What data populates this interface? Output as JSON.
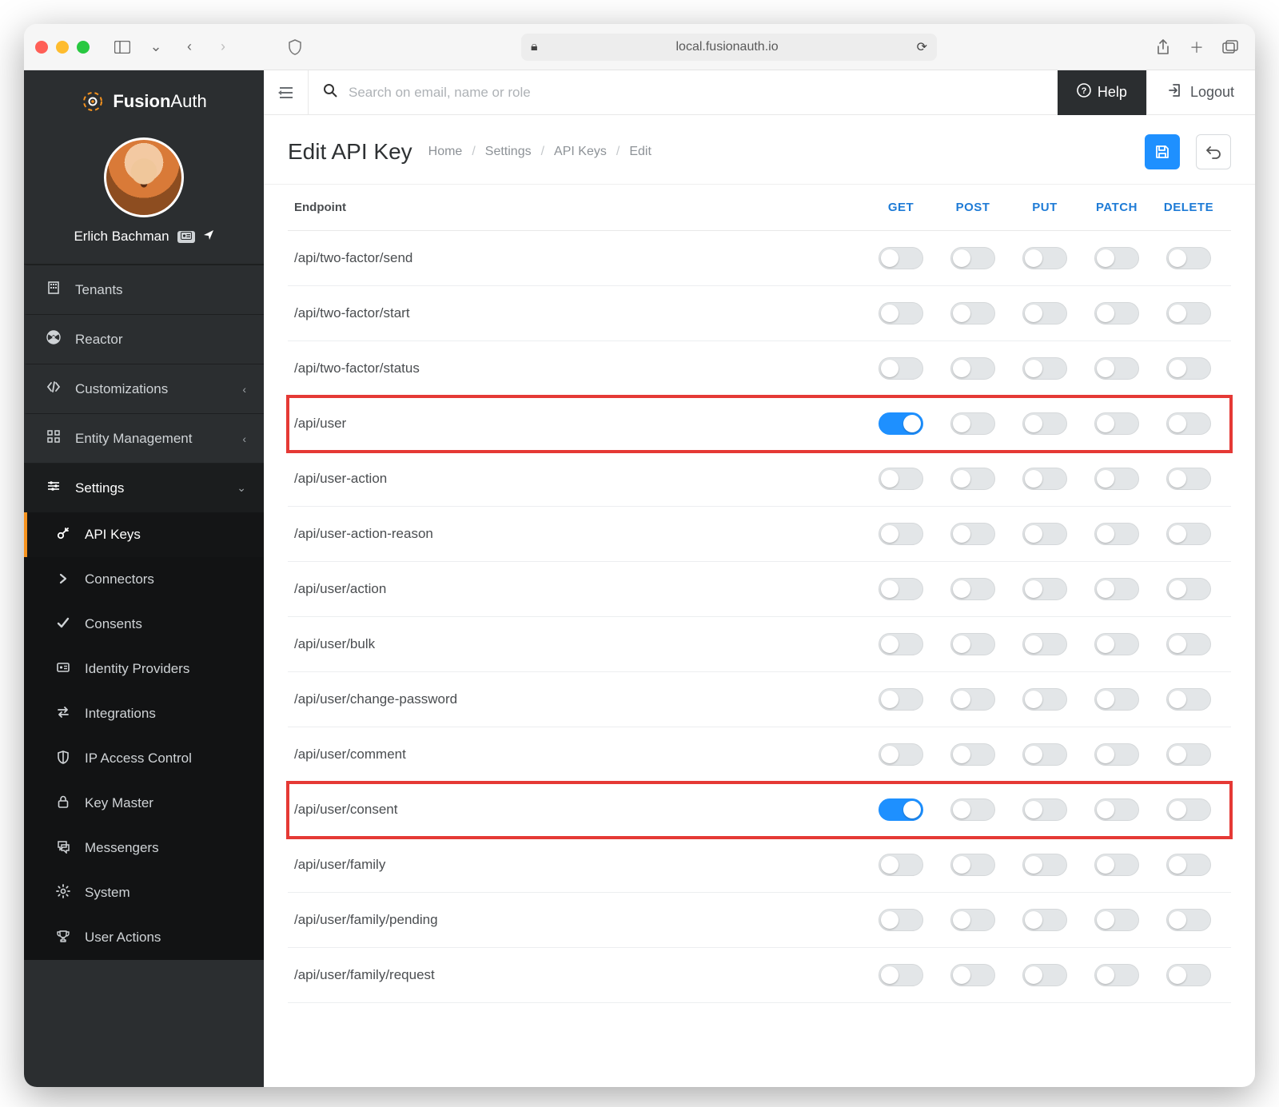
{
  "browser": {
    "url": "local.fusionauth.io"
  },
  "brand": {
    "name_a": "Fusion",
    "name_b": "Auth"
  },
  "profile": {
    "name": "Erlich Bachman"
  },
  "sidebar": {
    "primary": [
      {
        "icon": "building",
        "label": "Tenants"
      },
      {
        "icon": "nuclear",
        "label": "Reactor"
      }
    ],
    "groups": [
      {
        "icon": "code",
        "label": "Customizations",
        "expandable": true
      },
      {
        "icon": "grid",
        "label": "Entity Management",
        "expandable": true
      },
      {
        "icon": "sliders",
        "label": "Settings",
        "expandable": true,
        "open": true
      }
    ],
    "settings_children": [
      {
        "icon": "key",
        "label": "API Keys",
        "active": true
      },
      {
        "icon": "chevron",
        "label": "Connectors"
      },
      {
        "icon": "check",
        "label": "Consents"
      },
      {
        "icon": "idcard",
        "label": "Identity Providers"
      },
      {
        "icon": "swap",
        "label": "Integrations"
      },
      {
        "icon": "shield",
        "label": "IP Access Control"
      },
      {
        "icon": "lock",
        "label": "Key Master"
      },
      {
        "icon": "chat",
        "label": "Messengers"
      },
      {
        "icon": "gear",
        "label": "System"
      },
      {
        "icon": "trophy",
        "label": "User Actions"
      }
    ]
  },
  "topbar": {
    "search_placeholder": "Search on email, name or role",
    "help": "Help",
    "logout": "Logout"
  },
  "page": {
    "title": "Edit API Key",
    "crumbs": [
      "Home",
      "Settings",
      "API Keys",
      "Edit"
    ]
  },
  "table": {
    "headers": {
      "endpoint": "Endpoint",
      "methods": [
        "GET",
        "POST",
        "PUT",
        "PATCH",
        "DELETE"
      ]
    },
    "rows": [
      {
        "endpoint": "/api/two-factor/send",
        "get": false,
        "post": false,
        "put": false,
        "patch": false,
        "delete": false,
        "highlight": false
      },
      {
        "endpoint": "/api/two-factor/start",
        "get": false,
        "post": false,
        "put": false,
        "patch": false,
        "delete": false,
        "highlight": false
      },
      {
        "endpoint": "/api/two-factor/status",
        "get": false,
        "post": false,
        "put": false,
        "patch": false,
        "delete": false,
        "highlight": false
      },
      {
        "endpoint": "/api/user",
        "get": true,
        "post": false,
        "put": false,
        "patch": false,
        "delete": false,
        "highlight": true
      },
      {
        "endpoint": "/api/user-action",
        "get": false,
        "post": false,
        "put": false,
        "patch": false,
        "delete": false,
        "highlight": false
      },
      {
        "endpoint": "/api/user-action-reason",
        "get": false,
        "post": false,
        "put": false,
        "patch": false,
        "delete": false,
        "highlight": false
      },
      {
        "endpoint": "/api/user/action",
        "get": false,
        "post": false,
        "put": false,
        "patch": false,
        "delete": false,
        "highlight": false
      },
      {
        "endpoint": "/api/user/bulk",
        "get": false,
        "post": false,
        "put": false,
        "patch": false,
        "delete": false,
        "highlight": false
      },
      {
        "endpoint": "/api/user/change-password",
        "get": false,
        "post": false,
        "put": false,
        "patch": false,
        "delete": false,
        "highlight": false
      },
      {
        "endpoint": "/api/user/comment",
        "get": false,
        "post": false,
        "put": false,
        "patch": false,
        "delete": false,
        "highlight": false
      },
      {
        "endpoint": "/api/user/consent",
        "get": true,
        "post": false,
        "put": false,
        "patch": false,
        "delete": false,
        "highlight": true
      },
      {
        "endpoint": "/api/user/family",
        "get": false,
        "post": false,
        "put": false,
        "patch": false,
        "delete": false,
        "highlight": false
      },
      {
        "endpoint": "/api/user/family/pending",
        "get": false,
        "post": false,
        "put": false,
        "patch": false,
        "delete": false,
        "highlight": false
      },
      {
        "endpoint": "/api/user/family/request",
        "get": false,
        "post": false,
        "put": false,
        "patch": false,
        "delete": false,
        "highlight": false
      }
    ]
  }
}
